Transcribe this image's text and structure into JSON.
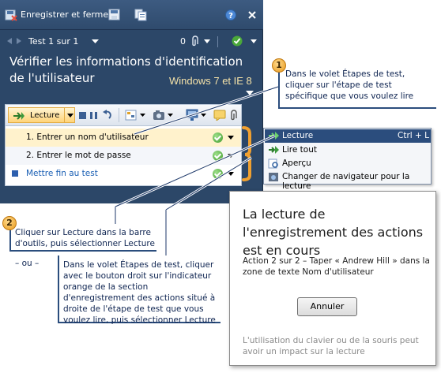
{
  "toolbar": {
    "save_close_label": "Enregistrer et fermer"
  },
  "nav": {
    "test_label": "Test 1 sur 1",
    "attachment_count": "0"
  },
  "main": {
    "title": "Vérifier les informations d'identification de l'utilisateur",
    "platform_note": "Windows 7 et IE 8"
  },
  "steps_toolbar": {
    "play_label": "Lecture"
  },
  "steps": [
    {
      "label": "1. Entrer un nom d'utilisateur"
    },
    {
      "label": "2. Entrer le mot de passe"
    },
    {
      "label": "Mettre fin au test"
    }
  ],
  "menu": {
    "items": [
      {
        "label": "Lecture",
        "shortcut": "Ctrl + L"
      },
      {
        "label": "Lire tout"
      },
      {
        "label": "Aperçu"
      },
      {
        "label": "Changer de navigateur pour la lecture"
      }
    ]
  },
  "dialog": {
    "title": "La lecture de l'enregistrement des actions est en cours",
    "action": "Action 2 sur 2 – Taper « Andrew Hill » dans la zone de texte Nom d'utilisateur",
    "cancel_label": "Annuler",
    "note": "L'utilisation du clavier ou de la souris peut avoir un impact sur la lecture"
  },
  "callouts": {
    "c1_number": "1",
    "c1_text": "Dans le volet Étapes de test, cliquer sur l'étape de test spécifique que vous voulez lire",
    "c2_number": "2",
    "c2_text": "Cliquer sur Lecture dans la barre d'outils, puis sélectionner Lecture",
    "or_text": "– ou –",
    "c3_text": "Dans le volet Étapes de test, cliquer avec le bouton droit sur l'indicateur orange de la section d'enregistrement des actions situé à droite de l'étape de test que vous voulez lire, puis sélectionner Lecture"
  },
  "colors": {
    "panel_bg": "#2c4768",
    "selection_bg": "#fff2cc",
    "menu_highlight": "#2b4d7d",
    "accent_orange": "#f0a030"
  },
  "icons": [
    "save-close-icon",
    "save-icon",
    "copy-icon",
    "help-icon",
    "close-icon",
    "prev-icon",
    "next-icon",
    "attachment-icon",
    "status-pass-icon",
    "play-icon",
    "stop-icon",
    "pause-icon",
    "undo-icon",
    "screenshot-icon",
    "camera-icon",
    "monitor-icon",
    "comment-icon",
    "paperclip-icon",
    "collapse-icon"
  ]
}
